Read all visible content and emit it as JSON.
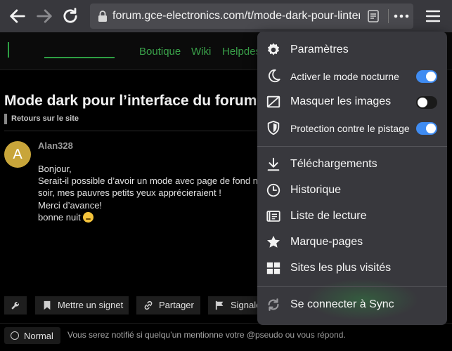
{
  "browser": {
    "url": "forum.gce-electronics.com/t/mode-dark-pour-linterface...",
    "icons": {
      "back": "arrow-left-icon",
      "forward": "arrow-right-icon",
      "reload": "reload-icon",
      "lock": "lock-icon",
      "reader": "reader-view-icon",
      "page_actions": "more-dots-icon",
      "menu": "hamburger-icon"
    }
  },
  "site": {
    "nav": [
      "Boutique",
      "Wiki",
      "Helpdesk"
    ],
    "accent": "#3aa24a"
  },
  "topic": {
    "title": "Mode dark pour l’interface du forum",
    "category": "Retours sur le site",
    "post": {
      "avatar_letter": "A",
      "author": "Alan328",
      "lines": [
        "Bonjour,",
        "Serait-il possible d’avoir un mode avec page de fond noire",
        "soir, mes pauvres petits yeux apprécieraient !",
        "Merci d’avance!",
        "bonne nuit"
      ]
    }
  },
  "actions": {
    "buttons": [
      "Mettre un signet",
      "Partager",
      "Signaler"
    ],
    "notification_level": "Normal",
    "notification_text": "Vous serez notifié si quelqu’un mentionne votre @pseudo ou vous répond."
  },
  "menu": {
    "items": [
      {
        "label": "Paramètres",
        "icon": "gear-icon"
      },
      {
        "label": "Activer le mode nocturne",
        "icon": "moon-icon",
        "toggle": true
      },
      {
        "label": "Masquer les images",
        "icon": "image-off-icon",
        "toggle": false
      },
      {
        "label": "Protection contre le pistage",
        "icon": "shield-icon",
        "toggle": true
      },
      {
        "label": "Téléchargements",
        "icon": "download-icon"
      },
      {
        "label": "Historique",
        "icon": "clock-icon"
      },
      {
        "label": "Liste de lecture",
        "icon": "reading-list-icon"
      },
      {
        "label": "Marque-pages",
        "icon": "star-icon"
      },
      {
        "label": "Sites les plus visités",
        "icon": "grid-icon"
      },
      {
        "label": "Se connecter à Sync",
        "icon": "sync-icon"
      }
    ],
    "toggle_on_color": "#3f8cf2"
  }
}
